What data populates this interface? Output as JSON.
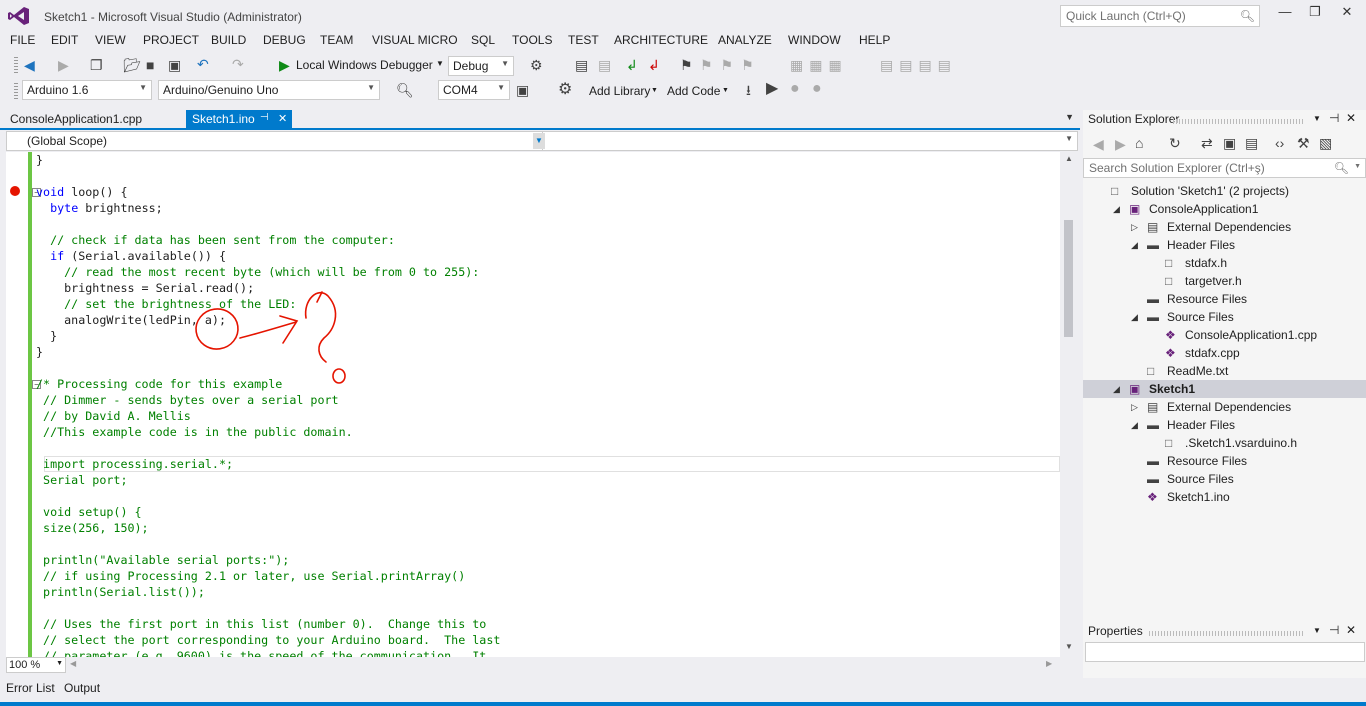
{
  "window": {
    "title": "Sketch1 - Microsoft Visual Studio (Administrator)",
    "quick_launch_placeholder": "Quick Launch (Ctrl+Q)",
    "minimize": "—",
    "restore": "❐",
    "close": "✕"
  },
  "menu": [
    "FILE",
    "EDIT",
    "VIEW",
    "PROJECT",
    "BUILD",
    "DEBUG",
    "TEAM",
    "VISUAL MICRO",
    "SQL",
    "TOOLS",
    "TEST",
    "ARCHITECTURE",
    "ANALYZE",
    "WINDOW",
    "HELP"
  ],
  "toolbar1": {
    "debugger_label": "Local Windows Debugger",
    "config": "Debug"
  },
  "toolbar2": {
    "arduino_version": "Arduino 1.6",
    "board": "Arduino/Genuino Uno",
    "port": "COM4",
    "add_library": "Add Library",
    "add_code": "Add Code"
  },
  "tabs": {
    "tab1": "ConsoleApplication1.cpp",
    "tab2": "Sketch1.ino",
    "pin": "⊣",
    "close": "✕"
  },
  "scope": "(Global Scope)",
  "code_lines": [
    {
      "t": "}",
      "c": "n",
      "i": 0
    },
    {
      "t": "",
      "c": "n",
      "i": 0
    },
    {
      "t": "void loop() {",
      "c": "kwfirst",
      "i": 0
    },
    {
      "t": "  byte brightness;",
      "c": "kwfirst2",
      "i": 0
    },
    {
      "t": "",
      "c": "n",
      "i": 0
    },
    {
      "t": "  // check if data has been sent from the computer:",
      "c": "cm",
      "i": 0
    },
    {
      "t": "  if (Serial.available()) {",
      "c": "if",
      "i": 0
    },
    {
      "t": "    // read the most recent byte (which will be from 0 to 255):",
      "c": "cm",
      "i": 0
    },
    {
      "t": "    brightness = Serial.read();",
      "c": "n",
      "i": 0
    },
    {
      "t": "    // set the brightness of the LED:",
      "c": "cm",
      "i": 0
    },
    {
      "t": "    analogWrite(ledPin, a);",
      "c": "n",
      "i": 0
    },
    {
      "t": "  }",
      "c": "n",
      "i": 0
    },
    {
      "t": "}",
      "c": "n",
      "i": 0
    },
    {
      "t": "",
      "c": "n",
      "i": 0
    },
    {
      "t": "/* Processing code for this example",
      "c": "cm",
      "i": 0
    },
    {
      "t": " // Dimmer - sends bytes over a serial port",
      "c": "cm",
      "i": 0
    },
    {
      "t": " // by David A. Mellis",
      "c": "cm",
      "i": 0
    },
    {
      "t": " //This example code is in the public domain.",
      "c": "cm",
      "i": 0
    },
    {
      "t": "",
      "c": "n",
      "i": 0
    },
    {
      "t": " import processing.serial.*;",
      "c": "cm",
      "i": 0
    },
    {
      "t": " Serial port;",
      "c": "cm",
      "i": 0
    },
    {
      "t": "",
      "c": "n",
      "i": 0
    },
    {
      "t": " void setup() {",
      "c": "cm",
      "i": 0
    },
    {
      "t": " size(256, 150);",
      "c": "cm",
      "i": 0
    },
    {
      "t": "",
      "c": "n",
      "i": 0
    },
    {
      "t": " println(\"Available serial ports:\");",
      "c": "cm",
      "i": 0
    },
    {
      "t": " // if using Processing 2.1 or later, use Serial.printArray()",
      "c": "cm",
      "i": 0
    },
    {
      "t": " println(Serial.list());",
      "c": "cm",
      "i": 0
    },
    {
      "t": "",
      "c": "n",
      "i": 0
    },
    {
      "t": " // Uses the first port in this list (number 0).  Change this to",
      "c": "cm",
      "i": 0
    },
    {
      "t": " // select the port corresponding to your Arduino board.  The last",
      "c": "cm",
      "i": 0
    },
    {
      "t": " // parameter (e.g. 9600) is the speed of the communication.  It",
      "c": "cm",
      "i": 0
    }
  ],
  "zoom": "100 %",
  "bottom_tabs": [
    "Error List",
    "Output"
  ],
  "solution_explorer": {
    "title": "Solution Explorer",
    "search_placeholder": "Search Solution Explorer (Ctrl+ş)",
    "tree": [
      {
        "label": "Solution 'Sketch1' (2 projects)",
        "level": 0,
        "arrow": "",
        "icon": "solution"
      },
      {
        "label": "ConsoleApplication1",
        "level": 1,
        "arrow": "◢",
        "icon": "project"
      },
      {
        "label": "External Dependencies",
        "level": 2,
        "arrow": "▷",
        "icon": "folder-ref"
      },
      {
        "label": "Header Files",
        "level": 2,
        "arrow": "◢",
        "icon": "folder"
      },
      {
        "label": "stdafx.h",
        "level": 3,
        "arrow": "",
        "icon": "h-file"
      },
      {
        "label": "targetver.h",
        "level": 3,
        "arrow": "",
        "icon": "h-file"
      },
      {
        "label": "Resource Files",
        "level": 2,
        "arrow": "",
        "icon": "folder"
      },
      {
        "label": "Source Files",
        "level": 2,
        "arrow": "◢",
        "icon": "folder"
      },
      {
        "label": "ConsoleApplication1.cpp",
        "level": 3,
        "arrow": "",
        "icon": "cpp-file"
      },
      {
        "label": "stdafx.cpp",
        "level": 3,
        "arrow": "",
        "icon": "cpp-file"
      },
      {
        "label": "ReadMe.txt",
        "level": 2,
        "arrow": "",
        "icon": "txt-file"
      },
      {
        "label": "Sketch1",
        "level": 1,
        "arrow": "◢",
        "icon": "project",
        "selected": true
      },
      {
        "label": "External Dependencies",
        "level": 2,
        "arrow": "▷",
        "icon": "folder-ref"
      },
      {
        "label": "Header Files",
        "level": 2,
        "arrow": "◢",
        "icon": "folder"
      },
      {
        "label": ".Sketch1.vsarduino.h",
        "level": 3,
        "arrow": "",
        "icon": "h-file"
      },
      {
        "label": "Resource Files",
        "level": 2,
        "arrow": "",
        "icon": "folder"
      },
      {
        "label": "Source Files",
        "level": 2,
        "arrow": "",
        "icon": "folder"
      },
      {
        "label": "Sketch1.ino",
        "level": 2,
        "arrow": "",
        "icon": "cpp-file"
      }
    ]
  },
  "properties": {
    "title": "Properties"
  },
  "colors": {
    "accent": "#007acc",
    "green_margin": "#6cc644",
    "annotation": "#e51400"
  }
}
